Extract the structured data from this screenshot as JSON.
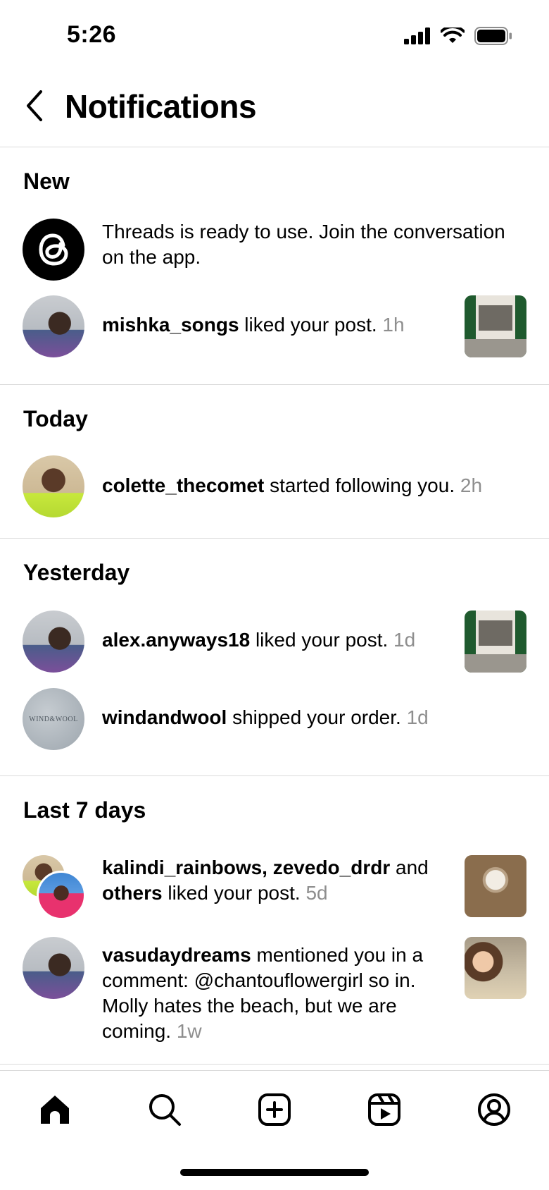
{
  "status": {
    "time": "5:26"
  },
  "header": {
    "title": "Notifications"
  },
  "sections": {
    "new": {
      "title": "New",
      "threads": {
        "text": "Threads is ready to use. Join the conversation on the app."
      },
      "like1": {
        "user": "mishka_songs",
        "text": " liked your post. ",
        "time": "1h"
      }
    },
    "today": {
      "title": "Today",
      "follow": {
        "user": "colette_thecomet",
        "text": " started following you. ",
        "time": "2h"
      }
    },
    "yesterday": {
      "title": "Yesterday",
      "like": {
        "user": "alex.anyways18",
        "text": " liked your post. ",
        "time": "1d"
      },
      "order": {
        "user": "windandwool",
        "text": " shipped your order. ",
        "time": "1d",
        "avatar_text": "WIND&WOOL"
      }
    },
    "last7": {
      "title": "Last 7 days",
      "group_like": {
        "users": "kalindi_rainbows, zevedo_drdr",
        "and": " and ",
        "others": "others",
        "text": " liked your post. ",
        "time": "5d"
      },
      "mention": {
        "user": "vasudaydreams",
        "text": " mentioned you in a comment: @chantouflowergirl so in. Molly hates the beach, but we are coming. ",
        "time": "1w"
      }
    }
  },
  "tabs": [
    "home-icon",
    "search-icon",
    "create-icon",
    "reels-icon",
    "profile-icon"
  ]
}
